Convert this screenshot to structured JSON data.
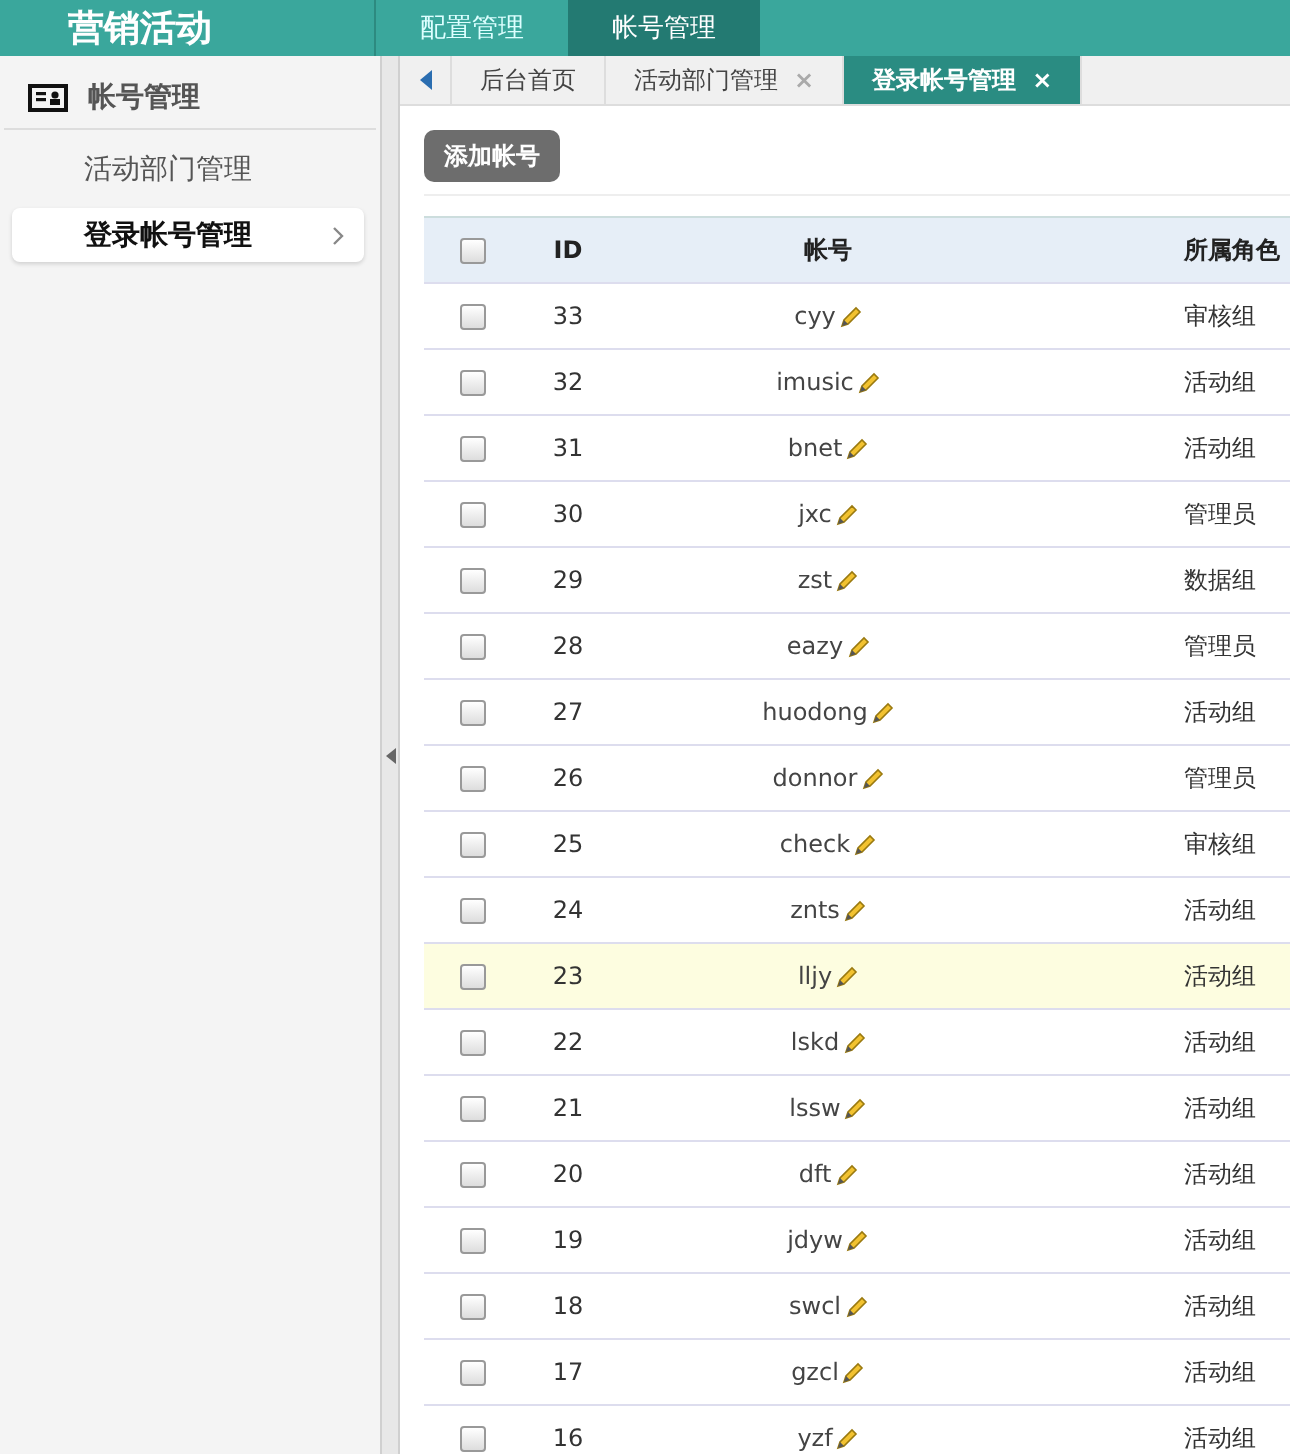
{
  "header": {
    "logo": "营销活动",
    "nav": [
      {
        "label": "配置管理",
        "selected": false
      },
      {
        "label": "帐号管理",
        "selected": true
      }
    ]
  },
  "sidebar": {
    "section": "帐号管理",
    "items": [
      {
        "label": "活动部门管理",
        "selected": false
      },
      {
        "label": "登录帐号管理",
        "selected": true
      }
    ]
  },
  "tabs": [
    {
      "label": "后台首页",
      "selected": false,
      "closable": false
    },
    {
      "label": "活动部门管理",
      "selected": false,
      "closable": true
    },
    {
      "label": "登录帐号管理",
      "selected": true,
      "closable": true
    }
  ],
  "tab_close": "×",
  "add_button": "添加帐号",
  "table": {
    "select_all_checked": false,
    "columns": [
      "ID",
      "帐号",
      "所属角色"
    ],
    "rows": [
      {
        "id": "33",
        "account": "cyy",
        "role": "审核组",
        "checked": false,
        "highlighted": false
      },
      {
        "id": "32",
        "account": "imusic",
        "role": "活动组",
        "checked": false,
        "highlighted": false
      },
      {
        "id": "31",
        "account": "bnet",
        "role": "活动组",
        "checked": false,
        "highlighted": false
      },
      {
        "id": "30",
        "account": "jxc",
        "role": "管理员",
        "checked": false,
        "highlighted": false
      },
      {
        "id": "29",
        "account": "zst",
        "role": "数据组",
        "checked": false,
        "highlighted": false
      },
      {
        "id": "28",
        "account": "eazy",
        "role": "管理员",
        "checked": false,
        "highlighted": false
      },
      {
        "id": "27",
        "account": "huodong",
        "role": "活动组",
        "checked": false,
        "highlighted": false
      },
      {
        "id": "26",
        "account": "donnor",
        "role": "管理员",
        "checked": false,
        "highlighted": false
      },
      {
        "id": "25",
        "account": "check",
        "role": "审核组",
        "checked": false,
        "highlighted": false
      },
      {
        "id": "24",
        "account": "znts",
        "role": "活动组",
        "checked": false,
        "highlighted": false
      },
      {
        "id": "23",
        "account": "lljy",
        "role": "活动组",
        "checked": false,
        "highlighted": true
      },
      {
        "id": "22",
        "account": "lskd",
        "role": "活动组",
        "checked": false,
        "highlighted": false
      },
      {
        "id": "21",
        "account": "lssw",
        "role": "活动组",
        "checked": false,
        "highlighted": false
      },
      {
        "id": "20",
        "account": "dft",
        "role": "活动组",
        "checked": false,
        "highlighted": false
      },
      {
        "id": "19",
        "account": "jdyw",
        "role": "活动组",
        "checked": false,
        "highlighted": false
      },
      {
        "id": "18",
        "account": "swcl",
        "role": "活动组",
        "checked": false,
        "highlighted": false
      },
      {
        "id": "17",
        "account": "gzcl",
        "role": "活动组",
        "checked": false,
        "highlighted": false
      },
      {
        "id": "16",
        "account": "yzf",
        "role": "活动组",
        "checked": false,
        "highlighted": false
      }
    ]
  }
}
